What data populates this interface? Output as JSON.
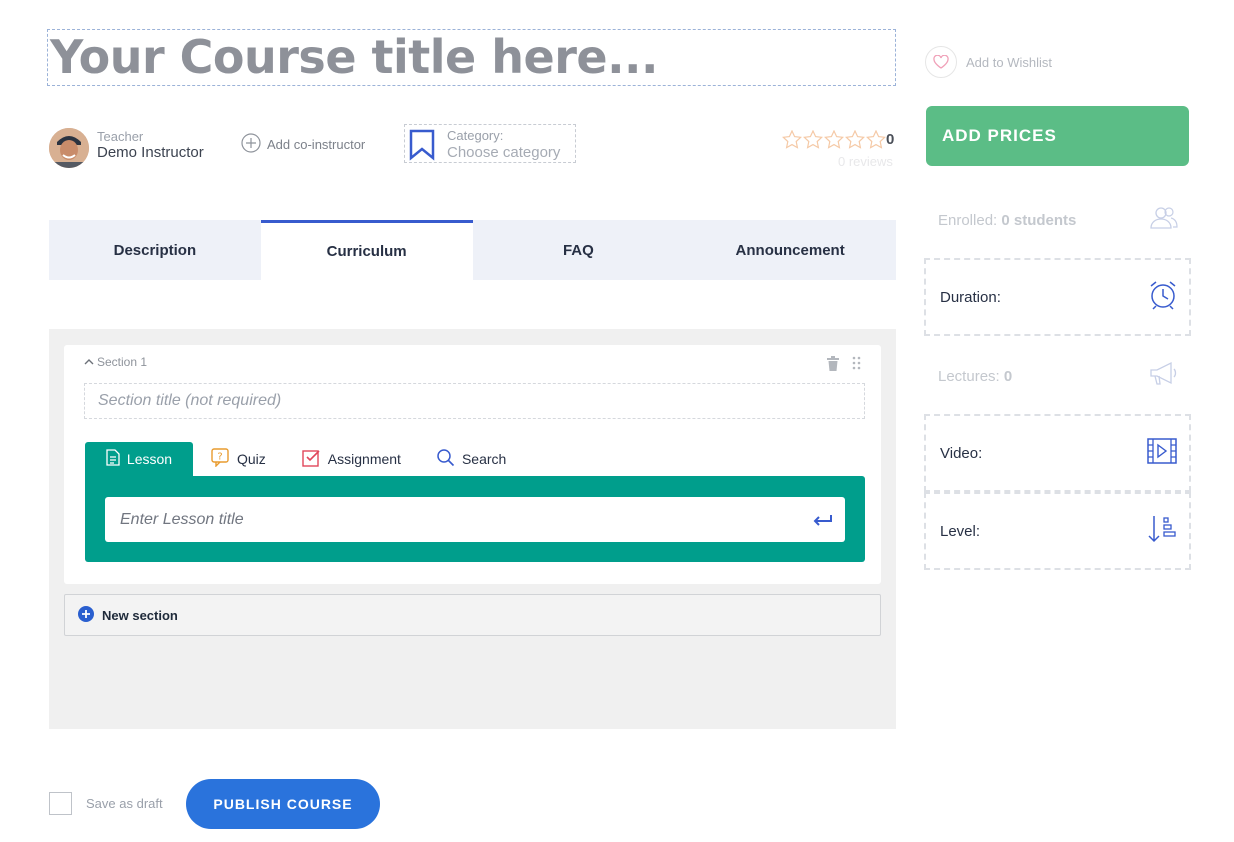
{
  "header": {
    "title_placeholder": "Your Course title here...",
    "teacher_role": "Teacher",
    "teacher_name": "Demo Instructor",
    "add_coinstructor": "Add co-instructor",
    "category_label": "Category:",
    "category_placeholder": "Choose category",
    "rating_value": "0",
    "reviews": "0 reviews"
  },
  "tabs": [
    "Description",
    "Curriculum",
    "FAQ",
    "Announcement"
  ],
  "curriculum": {
    "section_label": "Section 1",
    "section_title_placeholder": "Section title (not required)",
    "lesson_tabs": [
      "Lesson",
      "Quiz",
      "Assignment",
      "Search"
    ],
    "lesson_title_placeholder": "Enter Lesson title",
    "new_section": "New section"
  },
  "footer": {
    "save_draft": "Save as draft",
    "publish": "PUBLISH COURSE"
  },
  "sidebar": {
    "wishlist": "Add to Wishlist",
    "add_prices": "ADD PRICES",
    "enrolled_label": "Enrolled:",
    "enrolled_value": "0 students",
    "duration_label": "Duration:",
    "lectures_label": "Lectures:",
    "lectures_value": "0",
    "video_label": "Video:",
    "level_label": "Level:"
  },
  "colors": {
    "accent_blue": "#385bce",
    "lesson_green": "#009e8c",
    "prices_green": "#5bbd86",
    "publish_blue": "#2a73dc"
  }
}
